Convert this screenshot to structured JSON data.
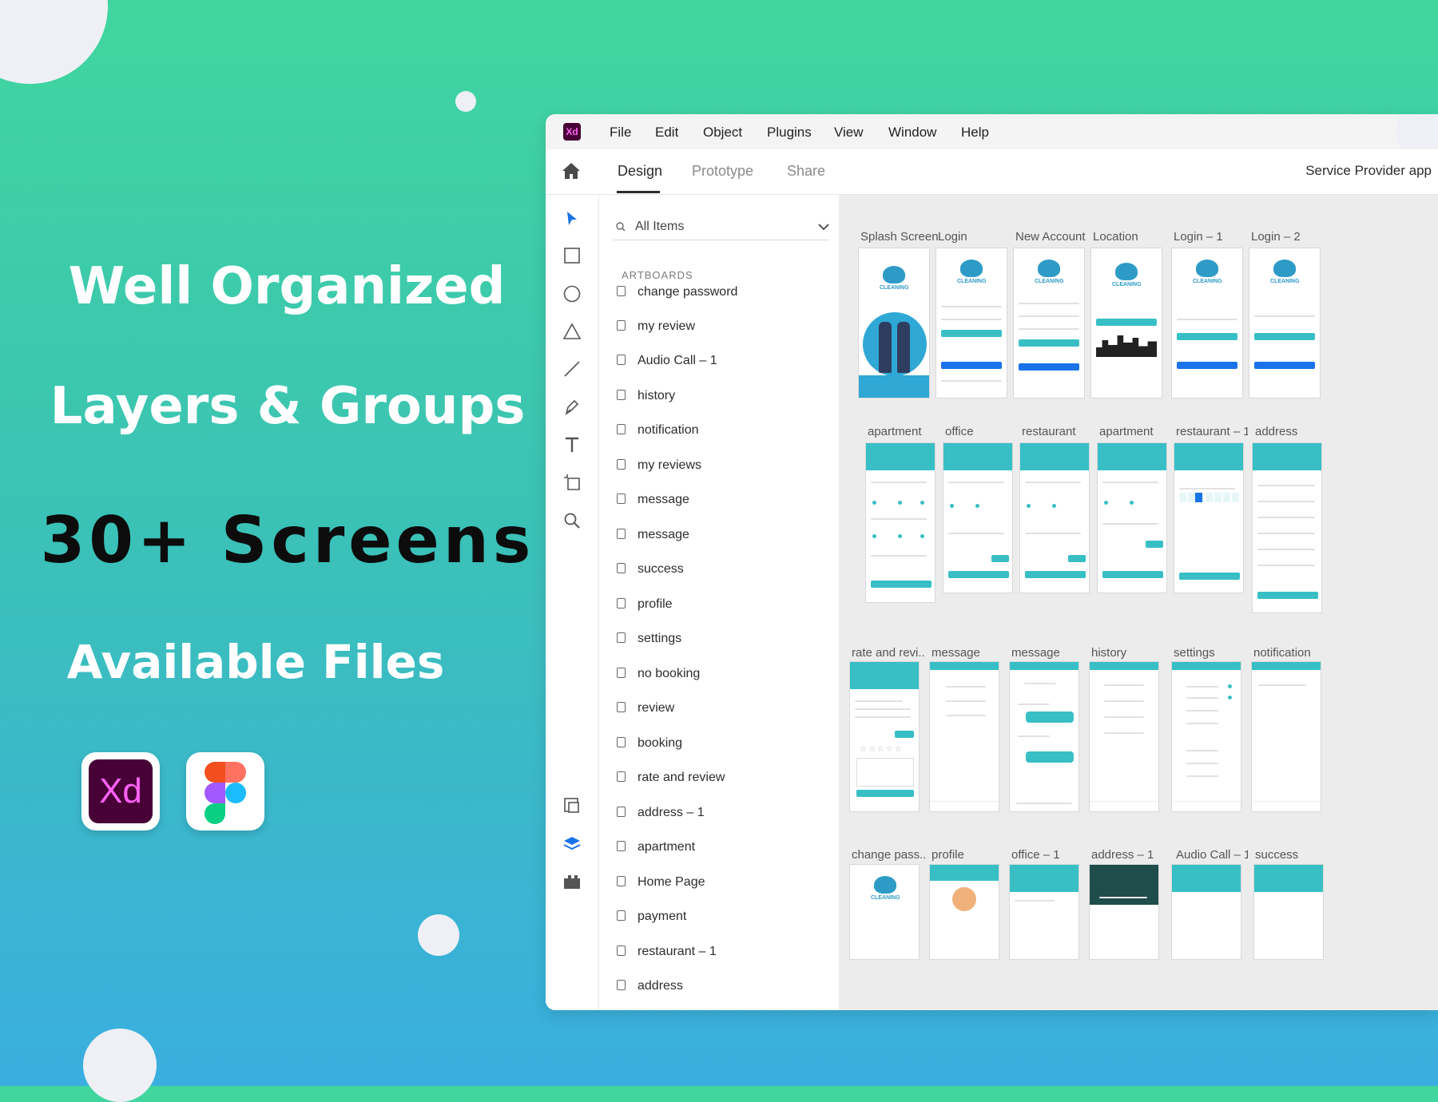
{
  "promo": {
    "line1": "Well Organized",
    "line2": "Layers & Groups",
    "line3": "30+ Screens",
    "line4": "Available Files",
    "xd_label": "Xd"
  },
  "window": {
    "logo": "Xd",
    "menu": [
      "File",
      "Edit",
      "Object",
      "Plugins",
      "View",
      "Window",
      "Help"
    ],
    "tabs": [
      "Design",
      "Prototype",
      "Share"
    ],
    "active_tab": "Design",
    "document_title": "Service Provider app"
  },
  "layers_panel": {
    "search_placeholder": "All Items",
    "section_title": "ARTBOARDS",
    "items": [
      "change password",
      "my review",
      "Audio Call – 1",
      "history",
      "notification",
      "my reviews",
      "message",
      "message",
      "success",
      "profile",
      "settings",
      "no booking",
      "review",
      "booking",
      "rate and review",
      "address – 1",
      "apartment",
      "Home Page",
      "payment",
      "restaurant – 1",
      "address"
    ]
  },
  "artboards": {
    "row1": [
      "Splash Screen",
      "Login",
      "New Account",
      "Location",
      "Login – 1",
      "Login – 2"
    ],
    "row2": [
      "apartment",
      "office",
      "restaurant",
      "apartment",
      "restaurant – 1",
      "address"
    ],
    "row3": [
      "rate and revi...",
      "message",
      "message",
      "history",
      "settings",
      "notification"
    ],
    "row4": [
      "change pass...",
      "profile",
      "office – 1",
      "address – 1",
      "Audio Call – 1",
      "success"
    ],
    "logo_text": "CLEANING"
  },
  "colors": {
    "accent": "#38bfc5",
    "brand_xd": "#470137",
    "xd_pink": "#ff61f6"
  }
}
